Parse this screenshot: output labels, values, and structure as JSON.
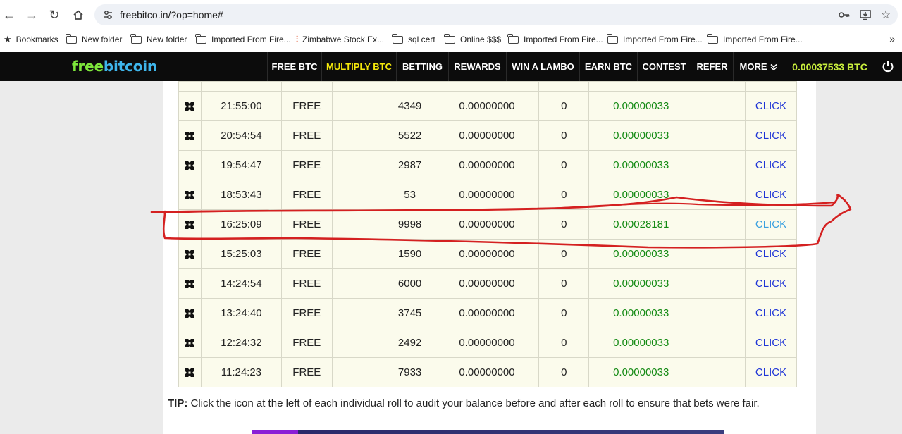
{
  "browser": {
    "url": "freebitco.in/?op=home#",
    "bookmarks": [
      {
        "label": "Bookmarks",
        "icon": "star-icon"
      },
      {
        "label": "New folder",
        "icon": "folder-icon"
      },
      {
        "label": "New folder",
        "icon": "folder-icon"
      },
      {
        "label": "Imported From Fire...",
        "icon": "folder-icon"
      },
      {
        "label": "Zimbabwe Stock Ex...",
        "icon": "chart-icon"
      },
      {
        "label": "sql cert",
        "icon": "folder-icon"
      },
      {
        "label": "Online $$$",
        "icon": "folder-icon"
      },
      {
        "label": "Imported From Fire...",
        "icon": "folder-icon"
      },
      {
        "label": "Imported From Fire...",
        "icon": "folder-icon"
      },
      {
        "label": "Imported From Fire...",
        "icon": "folder-icon"
      }
    ],
    "more_glyph": "»"
  },
  "site": {
    "logo_free": "free",
    "logo_bitcoin": "bitcoin",
    "nav": [
      {
        "label": "FREE BTC"
      },
      {
        "label": "MULTIPLY BTC",
        "active": true
      },
      {
        "label": "BETTING"
      },
      {
        "label": "REWARDS"
      },
      {
        "label": "WIN A LAMBO"
      },
      {
        "label": "EARN BTC"
      },
      {
        "label": "CONTEST"
      },
      {
        "label": "REFER"
      },
      {
        "label": "MORE"
      }
    ],
    "balance": "0.00037533 BTC",
    "colors": {
      "nav_bg": "#0c0c0c",
      "active": "#f5e90a",
      "win": "#138a13",
      "click": "#1f35d6",
      "annotation": "#d42020"
    }
  },
  "rolls": [
    {
      "time": "21:55:00",
      "type": "FREE",
      "roll": "4349",
      "balance": "0.00000000",
      "bet": "0",
      "win": "0.00000033",
      "action": "CLICK"
    },
    {
      "time": "20:54:54",
      "type": "FREE",
      "roll": "5522",
      "balance": "0.00000000",
      "bet": "0",
      "win": "0.00000033",
      "action": "CLICK"
    },
    {
      "time": "19:54:47",
      "type": "FREE",
      "roll": "2987",
      "balance": "0.00000000",
      "bet": "0",
      "win": "0.00000033",
      "action": "CLICK"
    },
    {
      "time": "18:53:43",
      "type": "FREE",
      "roll": "53",
      "balance": "0.00000000",
      "bet": "0",
      "win": "0.00000033",
      "action": "CLICK"
    },
    {
      "time": "16:25:09",
      "type": "FREE",
      "roll": "9998",
      "balance": "0.00000000",
      "bet": "0",
      "win": "0.00028181",
      "action": "CLICK"
    },
    {
      "time": "15:25:03",
      "type": "FREE",
      "roll": "1590",
      "balance": "0.00000000",
      "bet": "0",
      "win": "0.00000033",
      "action": "CLICK"
    },
    {
      "time": "14:24:54",
      "type": "FREE",
      "roll": "6000",
      "balance": "0.00000000",
      "bet": "0",
      "win": "0.00000033",
      "action": "CLICK"
    },
    {
      "time": "13:24:40",
      "type": "FREE",
      "roll": "3745",
      "balance": "0.00000000",
      "bet": "0",
      "win": "0.00000033",
      "action": "CLICK"
    },
    {
      "time": "12:24:32",
      "type": "FREE",
      "roll": "2492",
      "balance": "0.00000000",
      "bet": "0",
      "win": "0.00000033",
      "action": "CLICK"
    },
    {
      "time": "11:24:23",
      "type": "FREE",
      "roll": "7933",
      "balance": "0.00000000",
      "bet": "0",
      "win": "0.00000033",
      "action": "CLICK"
    }
  ],
  "tip": {
    "label": "TIP:",
    "text": "Click the icon at the left of each individual roll to audit your balance before and after each roll to ensure that bets were fair."
  }
}
